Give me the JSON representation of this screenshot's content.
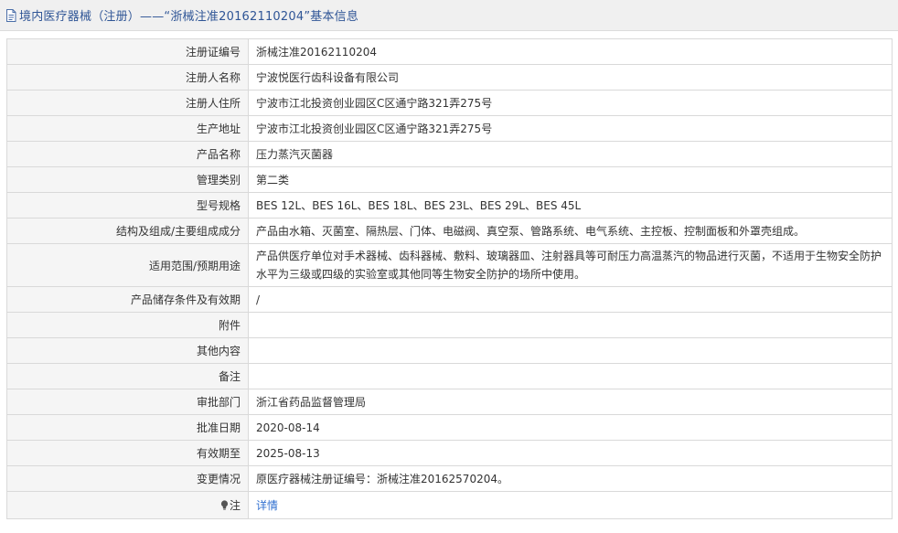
{
  "header": {
    "title": "境内医疗器械（注册）——“浙械注准20162110204”基本信息",
    "icon": "document-icon"
  },
  "rows": [
    {
      "label": "注册证编号",
      "value": "浙械注准20162110204"
    },
    {
      "label": "注册人名称",
      "value": "宁波悦医行齿科设备有限公司"
    },
    {
      "label": "注册人住所",
      "value": "宁波市江北投资创业园区C区通宁路321弄275号"
    },
    {
      "label": "生产地址",
      "value": "宁波市江北投资创业园区C区通宁路321弄275号"
    },
    {
      "label": "产品名称",
      "value": "压力蒸汽灭菌器"
    },
    {
      "label": "管理类别",
      "value": "第二类"
    },
    {
      "label": "型号规格",
      "value": "BES 12L、BES 16L、BES 18L、BES 23L、BES 29L、BES 45L"
    },
    {
      "label": "结构及组成/主要组成成分",
      "value": "产品由水箱、灭菌室、隔热层、门体、电磁阀、真空泵、管路系统、电气系统、主控板、控制面板和外罩壳组成。"
    },
    {
      "label": "适用范围/预期用途",
      "value": "产品供医疗单位对手术器械、齿科器械、敷料、玻璃器皿、注射器具等可耐压力高温蒸汽的物品进行灭菌，不适用于生物安全防护水平为三级或四级的实验室或其他同等生物安全防护的场所中使用。"
    },
    {
      "label": "产品储存条件及有效期",
      "value": "/"
    },
    {
      "label": "附件",
      "value": ""
    },
    {
      "label": "其他内容",
      "value": ""
    },
    {
      "label": "备注",
      "value": ""
    },
    {
      "label": "审批部门",
      "value": "浙江省药品监督管理局"
    },
    {
      "label": "批准日期",
      "value": "2020-08-14"
    },
    {
      "label": "有效期至",
      "value": "2025-08-13"
    },
    {
      "label": "变更情况",
      "value": "原医疗器械注册证编号：浙械注准20162570204。"
    }
  ],
  "note": {
    "label": "注",
    "icon": "lightbulb-icon",
    "link_text": "详情"
  },
  "colors": {
    "header_bg": "#f0f0f0",
    "title": "#2f5596",
    "label_bg": "#f5f5f5",
    "border": "#d9d9d9",
    "link": "#2f6fd0"
  }
}
